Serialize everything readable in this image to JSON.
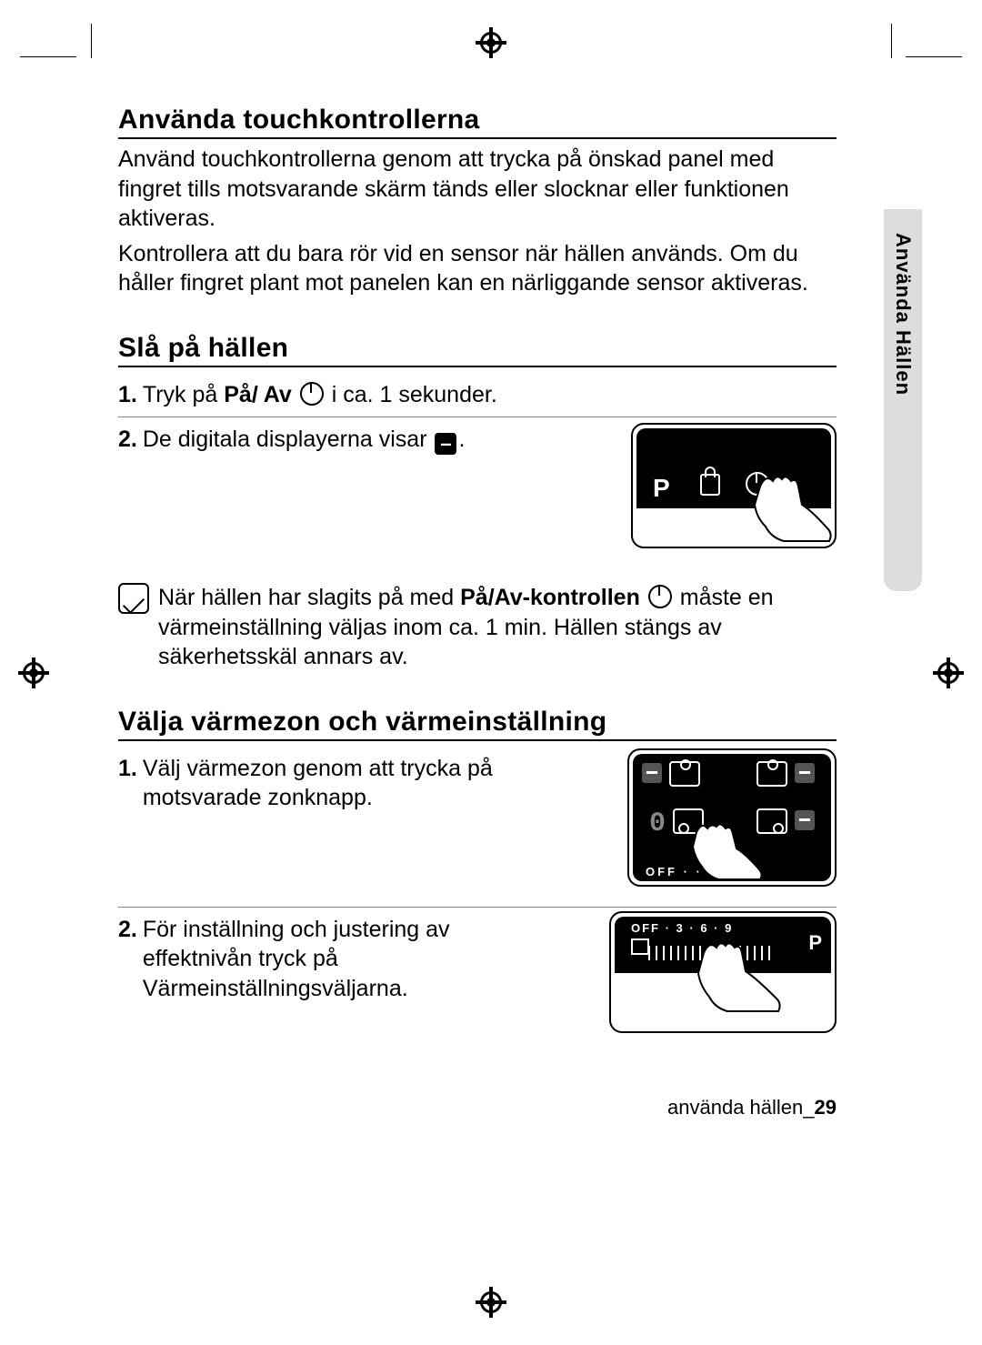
{
  "sideTab": "Använda Hällen",
  "sec1": {
    "title": "Använda touchkontrollerna",
    "p1": "Använd touchkontrollerna genom att trycka på önskad panel med fingret tills motsvarande skärm tänds eller slocknar eller funktionen aktiveras.",
    "p2": "Kontrollera att du bara rör vid en sensor när hällen används. Om du håller fingret plant mot panelen kan en närliggande sensor aktiveras."
  },
  "sec2": {
    "title": "Slå på hällen",
    "s1a": "Tryk på ",
    "s1b": "På/ Av",
    "s1c": " i ca. 1 sekunder.",
    "s2a": "De digitala displayerna visar ",
    "s2b": ".",
    "noteA": "När hällen har slagits på med ",
    "noteB": "På/Av-kontrollen",
    "noteC": " måste en värmeinställning väljas inom ca. 1 min. Hällen stängs av säkerhetsskäl annars av."
  },
  "sec3": {
    "title": "Välja värmezon och värmeinställning",
    "s1": "Välj värmezon genom att trycka på motsvarade zonknapp.",
    "s2": "För inställning och justering av effektnivån tryck på Värmeinställningsväljarna."
  },
  "illus2scale": "OFF  ·      ·   6  ·  9",
  "illus3scale": "OFF · 3 · 6 · 9",
  "footerText": "använda hällen_",
  "pageNum": "29",
  "nums": {
    "one": "1.",
    "two": "2."
  },
  "glyphs": {
    "minus": "–",
    "P": "P",
    "zero": "0"
  }
}
